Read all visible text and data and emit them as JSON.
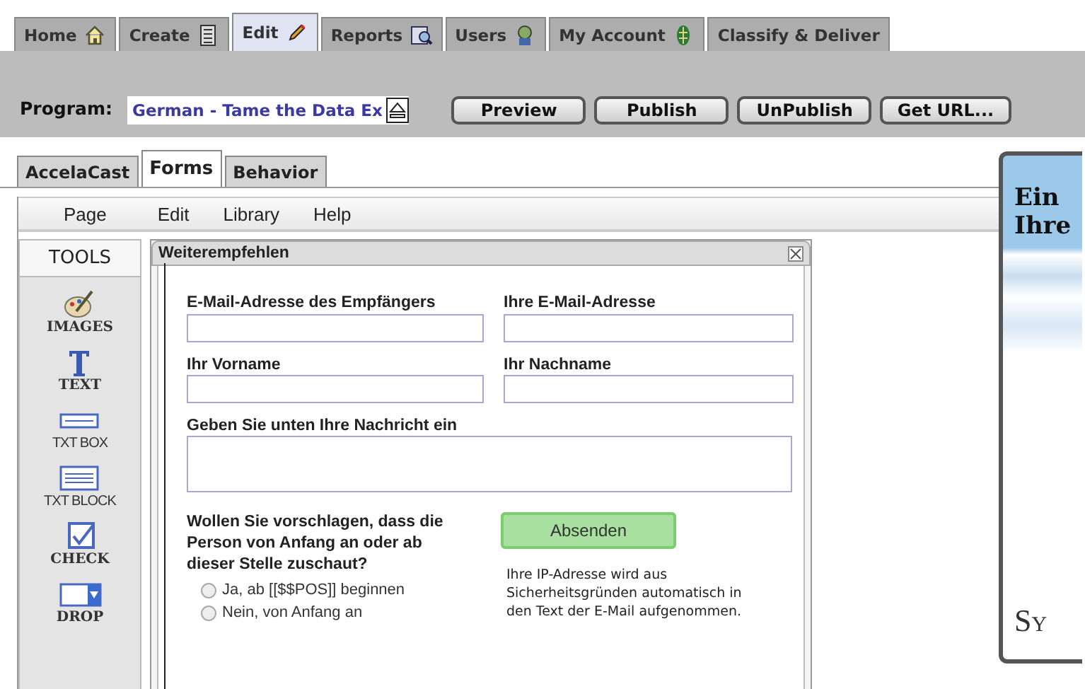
{
  "nav_tabs": [
    {
      "label": "Home",
      "selected": false
    },
    {
      "label": "Create",
      "selected": false
    },
    {
      "label": "Edit",
      "selected": true
    },
    {
      "label": "Reports",
      "selected": false
    },
    {
      "label": "Users",
      "selected": false
    },
    {
      "label": "My Account",
      "selected": false
    },
    {
      "label": "Classify & Deliver",
      "selected": false
    }
  ],
  "program": {
    "label": "Program:",
    "value": "German - Tame the Data Ex"
  },
  "actions": [
    "Preview",
    "Publish",
    "UnPublish",
    "Get URL..."
  ],
  "editor_tabs": [
    {
      "label": "AccelaCast",
      "selected": false
    },
    {
      "label": "Forms",
      "selected": true
    },
    {
      "label": "Behavior",
      "selected": false
    }
  ],
  "menu": [
    "Page",
    "Edit",
    "Library",
    "Help"
  ],
  "tools": {
    "title": "TOOLS",
    "items": [
      {
        "label": "IMAGES",
        "kind": "images"
      },
      {
        "label": "TEXT",
        "kind": "text"
      },
      {
        "label": "TXT BOX",
        "kind": "txtbox"
      },
      {
        "label": "TXT BLOCK",
        "kind": "txtblock"
      },
      {
        "label": "CHECK",
        "kind": "check"
      },
      {
        "label": "DROP",
        "kind": "drop"
      }
    ]
  },
  "form": {
    "title": "Weiterempfehlen",
    "fields": [
      {
        "label": "E-Mail-Adresse des Empfängers"
      },
      {
        "label": "Ihre E-Mail-Adresse"
      },
      {
        "label": "Ihr Vorname"
      },
      {
        "label": "Ihr Nachname"
      }
    ],
    "message_label": "Geben Sie unten Ihre Nachricht ein",
    "question": "Wollen Sie vorschlagen, dass die Person von Anfang an oder ab dieser Stelle zuschaut?",
    "options": [
      {
        "label": "Ja, ab [[$$POS]] beginnen",
        "selected": false
      },
      {
        "label": "Nein, von Anfang an",
        "selected": false
      }
    ],
    "submit": "Absenden",
    "note": "Ihre IP-Adresse wird aus Sicherheitsgründen automatisch in den Text der E-Mail aufgenommen."
  },
  "preview_card": {
    "lines": [
      "Ein",
      "Ihre"
    ],
    "footer": "Sy"
  }
}
